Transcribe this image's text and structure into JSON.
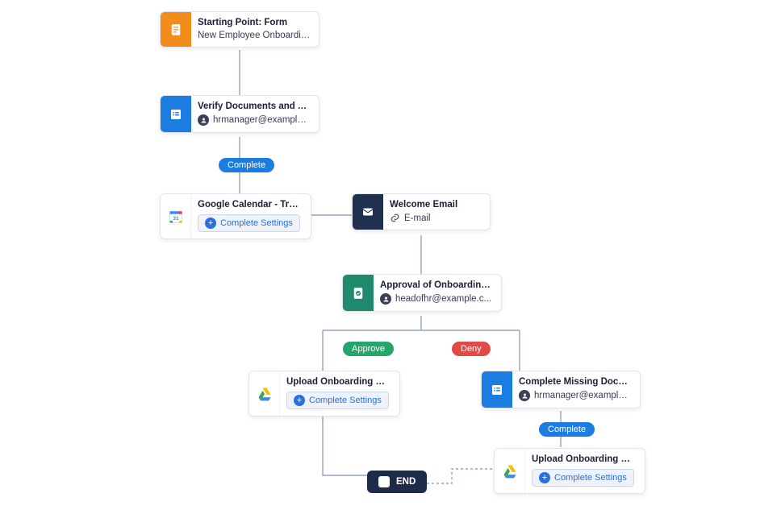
{
  "nodes": {
    "start": {
      "title": "Starting Point: Form",
      "subtitle": "New Employee Onboardin..."
    },
    "verify": {
      "title": "Verify Documents and Assig...",
      "assignee": "hrmanager@example...."
    },
    "gcal": {
      "title": "Google Calendar - Training S...",
      "button": "Complete Settings"
    },
    "welcome": {
      "title": "Welcome Email",
      "subtitle": "E-mail"
    },
    "approval": {
      "title": "Approval of Onboarding Pro...",
      "assignee": "headofhr@example.c..."
    },
    "upload1": {
      "title": "Upload Onboarding Docume...",
      "button": "Complete Settings"
    },
    "missing": {
      "title": "Complete Missing Documents",
      "assignee": "hrmanager@examplec..."
    },
    "upload2": {
      "title": "Upload Onboarding Docume...",
      "button": "Complete Settings"
    }
  },
  "pills": {
    "complete1": "Complete",
    "approve": "Approve",
    "deny": "Deny",
    "complete2": "Complete"
  },
  "end": "END",
  "colors": {
    "pill_blue": "#1b7de0",
    "pill_green": "#25a56a",
    "pill_red": "#e24a4a"
  }
}
